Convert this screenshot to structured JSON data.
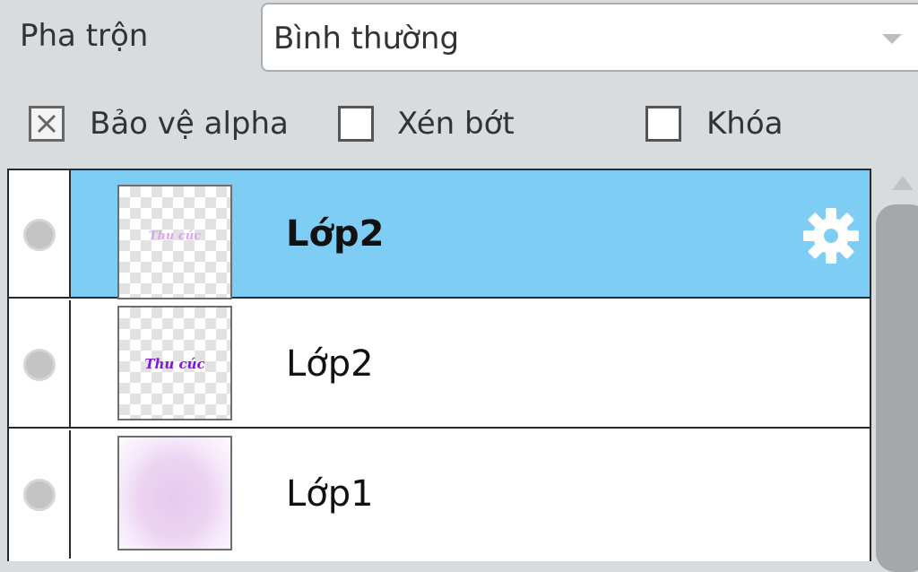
{
  "blend": {
    "label": "Pha trộn",
    "value": "Bình thường"
  },
  "options": {
    "protect_alpha": {
      "label": "Bảo vệ alpha",
      "checked": true
    },
    "clip": {
      "label": "Xén bớt",
      "checked": false
    },
    "lock": {
      "label": "Khóa",
      "checked": false
    }
  },
  "layers": [
    {
      "name": "Lớp2",
      "selected": true,
      "thumb_text": "Thu cúc",
      "thumb_color": "#d7a6f0"
    },
    {
      "name": "Lớp2",
      "selected": false,
      "thumb_text": "Thu cúc",
      "thumb_color": "#7a1ad6"
    },
    {
      "name": "Lớp1",
      "selected": false,
      "thumb_text": "",
      "thumb_color": "#e8c9ef"
    }
  ],
  "colors": {
    "selection": "#7ecdf4",
    "panel_bg": "#d8dcdf"
  }
}
